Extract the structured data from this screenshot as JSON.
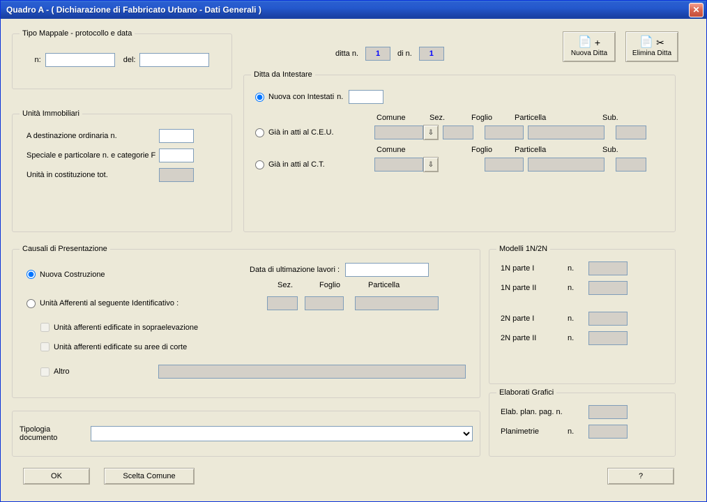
{
  "window": {
    "title": "Quadro A - ( Dichiarazione di Fabbricato Urbano - Dati Generali )"
  },
  "tipo_mappale": {
    "legend": "Tipo Mappale - protocollo e data",
    "n_label": "n:",
    "n_value": "",
    "del_label": "del:",
    "del_value": ""
  },
  "ditta_n": {
    "label": "ditta n.",
    "value": "1",
    "di_label": "di  n.",
    "di_value": "1"
  },
  "nuova_ditta_btn": "Nuova Ditta",
  "elimina_ditta_btn": "Elimina Ditta",
  "unita_immobiliari": {
    "legend": "Unità Immobiliari",
    "dest_ord": "A destinazione ordinaria  n.",
    "dest_ord_v": "",
    "speciale": "Speciale e particolare     n. e categorie F",
    "speciale_v": "",
    "costituz": "Unità in costituzione      tot.",
    "costituz_v": ""
  },
  "ditta_intestare": {
    "legend": "Ditta da Intestare",
    "nuova_label": "Nuova con Intestati",
    "nuova_n_label": "n.",
    "nuova_n_v": "",
    "ceu_label": "Già in atti al C.E.U.",
    "ct_label": "Già in atti al C.T.",
    "headers": {
      "comune": "Comune",
      "sez": "Sez.",
      "foglio": "Foglio",
      "particella": "Particella",
      "sub": "Sub."
    }
  },
  "causali": {
    "legend": "Causali di Presentazione",
    "nuova": "Nuova Costruzione",
    "afferenti": "Unità Afferenti al seguente Identificativo :",
    "data_label": "Data di ultimazione lavori :",
    "data_v": "",
    "headers": {
      "sez": "Sez.",
      "foglio": "Foglio",
      "particella": "Particella"
    },
    "chk1": "Unità afferenti edificate in sopraelevazione",
    "chk2": "Unità afferenti edificate su aree di corte",
    "chk3": "Altro",
    "altro_v": ""
  },
  "tipologia": {
    "label": "Tipologia documento",
    "value": ""
  },
  "modelli": {
    "legend": "Modelli 1N/2N",
    "r1": "1N parte I",
    "r1n": "n.",
    "r1v": "",
    "r2": "1N parte II",
    "r2n": "n.",
    "r2v": "",
    "r3": "2N parte I",
    "r3n": "n.",
    "r3v": "",
    "r4": "2N parte II",
    "r4n": "n.",
    "r4v": ""
  },
  "elaborati": {
    "legend": "Elaborati Grafici",
    "r1": "Elab. plan. pag. n.",
    "r1v": "",
    "r2": "Planimetrie",
    "r2n": "n.",
    "r2v": ""
  },
  "buttons": {
    "ok": "OK",
    "scelta": "Scelta Comune",
    "help": "?"
  }
}
